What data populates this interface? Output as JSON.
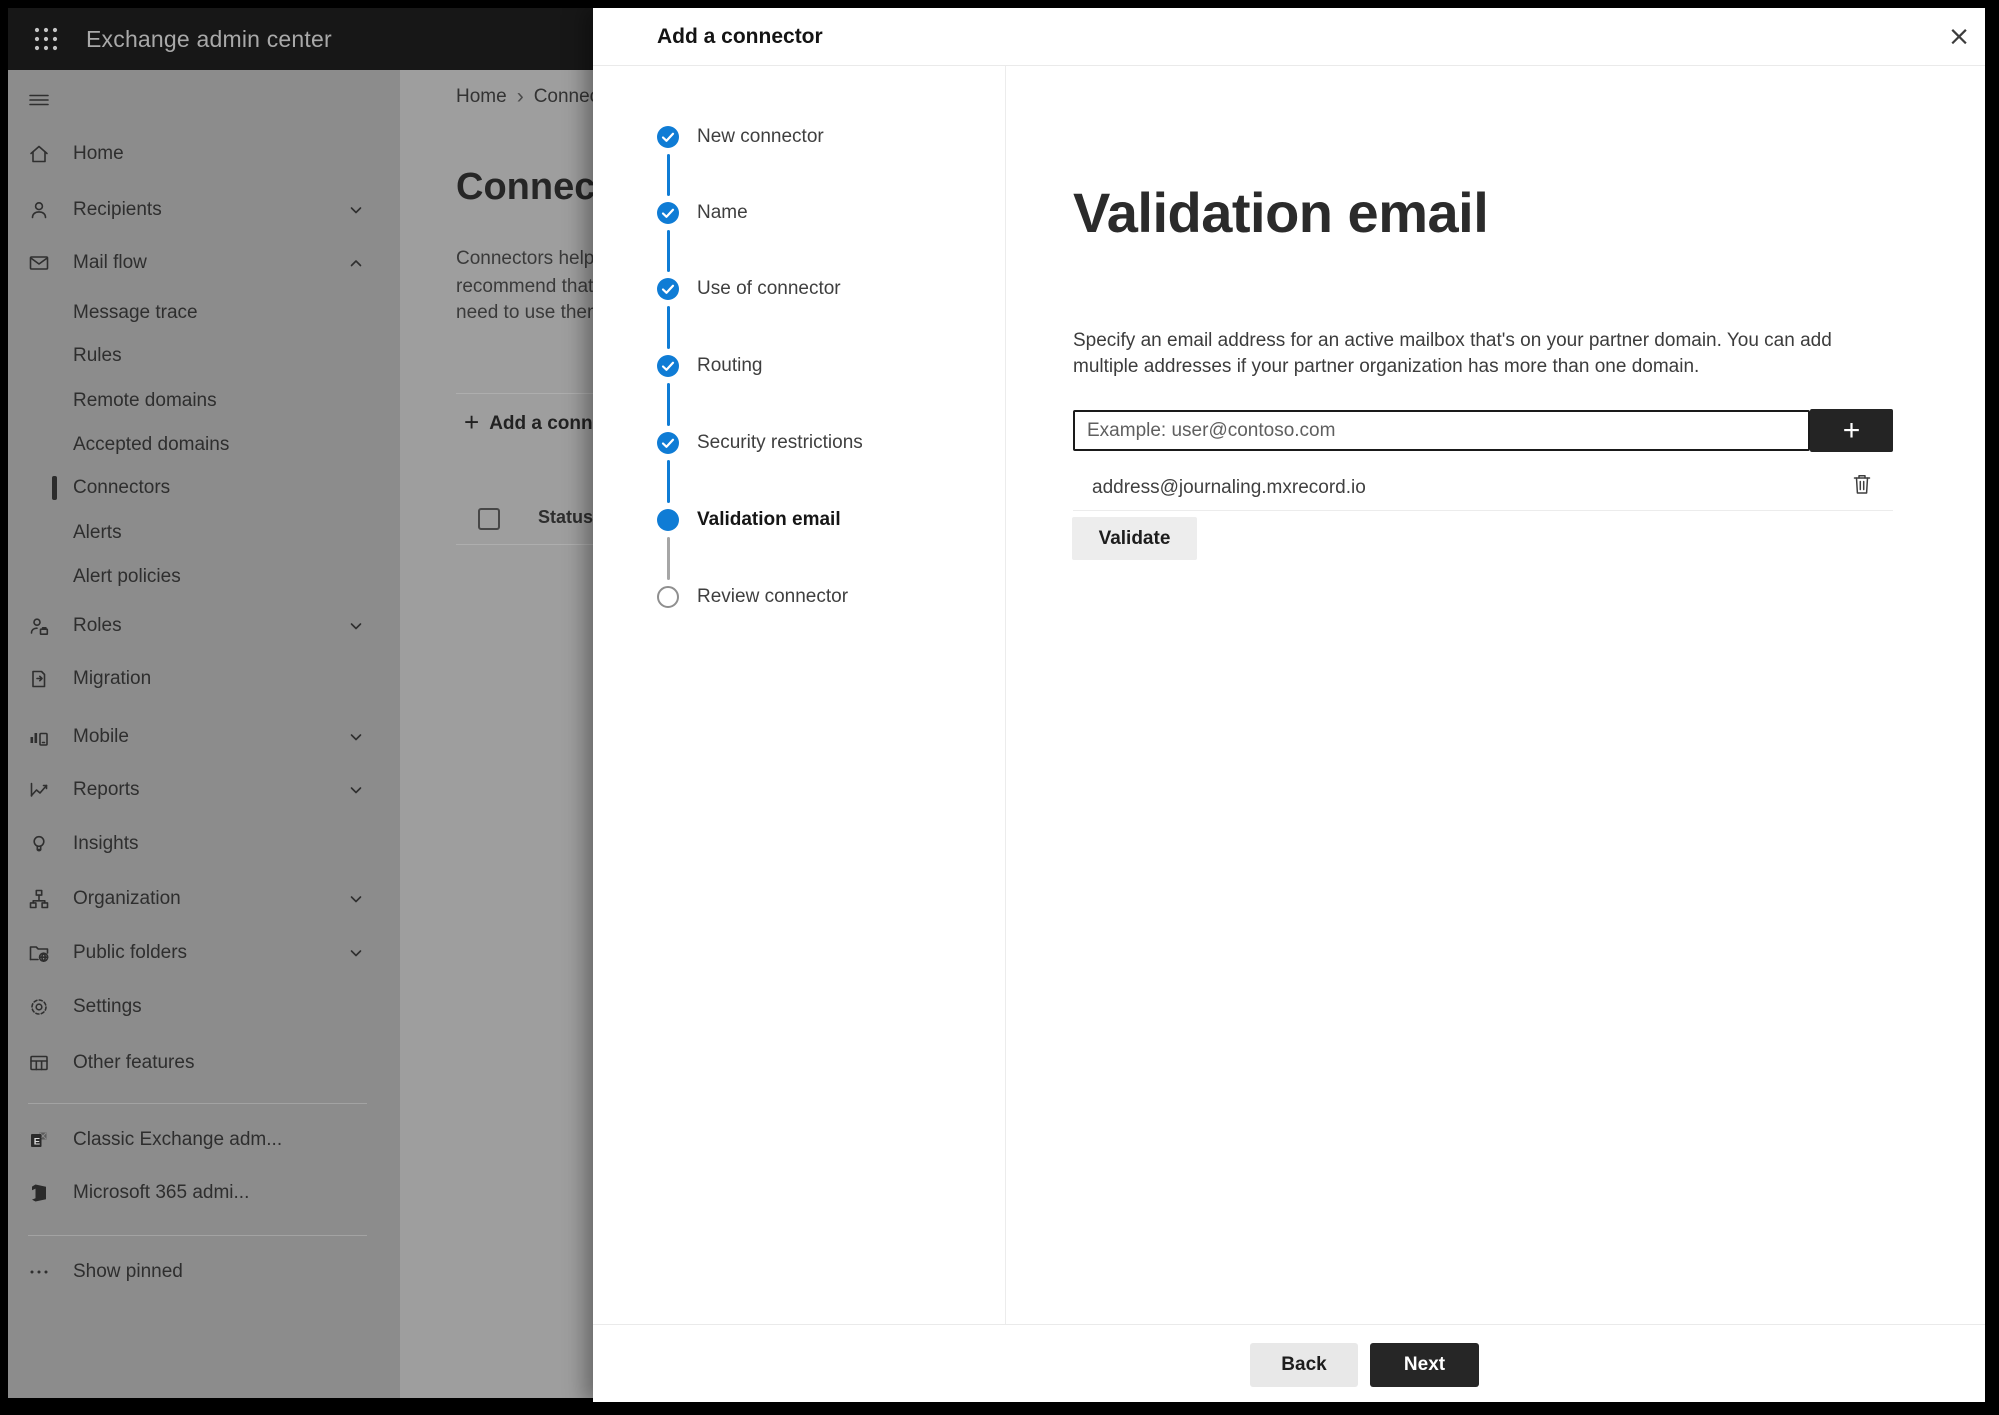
{
  "app": {
    "title": "Exchange admin center"
  },
  "colors": {
    "accent_blue": "#0f7cd5",
    "appbar_bg": "#171717",
    "sidebar_dimmed_bg": "#8c8c8c",
    "content_dimmed_bg": "#9e9e9e",
    "primary_button_bg": "#262626",
    "dialog_bg": "#ffffff"
  },
  "sidebar": {
    "items": [
      {
        "label": "Home"
      },
      {
        "label": "Recipients"
      },
      {
        "label": "Mail flow"
      },
      {
        "label": "Message trace"
      },
      {
        "label": "Rules"
      },
      {
        "label": "Remote domains"
      },
      {
        "label": "Accepted domains"
      },
      {
        "label": "Connectors",
        "selected": true
      },
      {
        "label": "Alerts"
      },
      {
        "label": "Alert policies"
      },
      {
        "label": "Roles"
      },
      {
        "label": "Migration"
      },
      {
        "label": "Mobile"
      },
      {
        "label": "Reports"
      },
      {
        "label": "Insights"
      },
      {
        "label": "Organization"
      },
      {
        "label": "Public folders"
      },
      {
        "label": "Settings"
      },
      {
        "label": "Other features"
      },
      {
        "label": "Classic Exchange adm..."
      },
      {
        "label": "Microsoft 365 admi..."
      },
      {
        "label": "Show pinned"
      }
    ]
  },
  "background": {
    "breadcrumb": {
      "home": "Home",
      "separator": "›",
      "current": "Connectors"
    },
    "heading": "Connectors",
    "paragraph_lines": [
      "Connectors help",
      "recommend that",
      "need to use them"
    ],
    "add_button": "Add a connector",
    "table": {
      "status_header": "Status"
    }
  },
  "dialog": {
    "title": "Add a connector",
    "close_icon": "×",
    "steps": [
      {
        "label": "New connector",
        "state": "completed"
      },
      {
        "label": "Name",
        "state": "completed"
      },
      {
        "label": "Use of connector",
        "state": "completed"
      },
      {
        "label": "Routing",
        "state": "completed"
      },
      {
        "label": "Security restrictions",
        "state": "completed"
      },
      {
        "label": "Validation email",
        "state": "current"
      },
      {
        "label": "Review connector",
        "state": "upcoming"
      }
    ],
    "content": {
      "heading": "Validation email",
      "description_lines": [
        "Specify an email address for an active mailbox that's on your partner domain. You can add",
        "multiple addresses if your partner organization has more than one domain."
      ],
      "email_input": {
        "value": "",
        "placeholder": "Example: user@contoso.com"
      },
      "add_address_button": "+",
      "addresses": [
        {
          "email": "address@journaling.mxrecord.io"
        }
      ],
      "validate_button": "Validate"
    },
    "footer": {
      "back": "Back",
      "next": "Next"
    }
  }
}
